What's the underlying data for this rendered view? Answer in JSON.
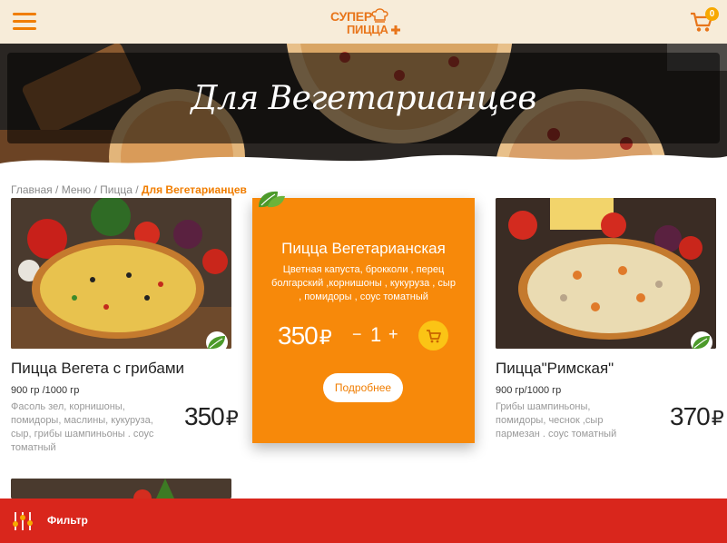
{
  "header": {
    "logo_line1": "СУПЕР",
    "logo_line2": "ПИЦЦА",
    "cart_count": "0",
    "brand_color": "#f07d00"
  },
  "hero": {
    "title": "Для Вегетарианцев"
  },
  "breadcrumb": {
    "items": [
      "Главная",
      "Меню",
      "Пицца"
    ],
    "separator": " / ",
    "current": "Для Вегетарианцев"
  },
  "products": [
    {
      "name": "Пицца Вегета с грибами",
      "weight": "900 гр /1000 гр",
      "description": "Фасоль зел, корнишоны, помидоры, маслины, кукуруза, сыр, грибы шампиньоны . соус томатный",
      "price": "350",
      "currency": "₽"
    },
    {
      "name": "Пицца\"Римская\"",
      "weight": "900 гр/1000 гр",
      "description": "Грибы шампиньоны, помидоры, чеснок ,сыр пармезан . соус томатный",
      "price": "370",
      "currency": "₽"
    }
  ],
  "featured": {
    "name": "Пицца Вегетарианская",
    "description": "Цветная капуста, брокколи , перец болгарский ,корнишоны , кукуруза , сыр , помидоры , соус томатный",
    "price": "350",
    "currency": "₽",
    "minus": "−",
    "quantity": "1",
    "plus": "+",
    "more_label": "Подробнее",
    "accent": "#f7890a"
  },
  "filter_bar": {
    "label": "Фильтр",
    "color": "#d9261c"
  },
  "icons": [
    "menu-icon",
    "chef-hat-icon",
    "cart-icon",
    "leaf-icon",
    "filter-icon"
  ]
}
